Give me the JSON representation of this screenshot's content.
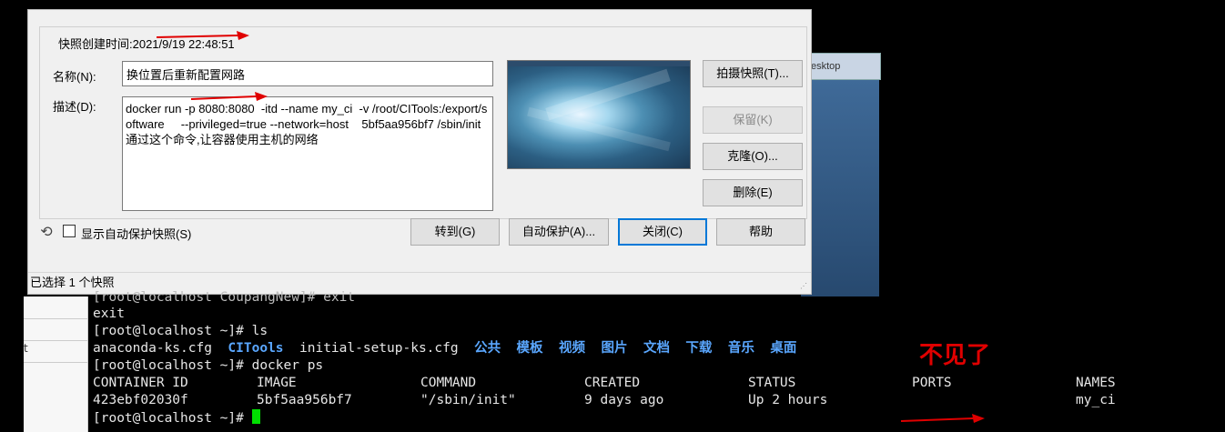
{
  "background_window": {
    "title": "esktop"
  },
  "dialog": {
    "snapshot_created_label": "快照创建时间:2021/9/19 22:48:51",
    "name_label": "名称(N):",
    "name_value": "换位置后重新配置网路",
    "desc_label": "描述(D):",
    "desc_value": "docker run -p 8080:8080  -itd --name my_ci  -v /root/CITools:/export/software     --privileged=true --network=host    5bf5aa956bf7 /sbin/init 通过这个命令,让容器使用主机的网络",
    "buttons": {
      "take_snapshot": "拍摄快照(T)...",
      "keep": "保留(K)",
      "clone": "克隆(O)...",
      "delete": "删除(E)",
      "goto": "转到(G)",
      "autoprotect": "自动保护(A)...",
      "close": "关闭(C)",
      "help": "帮助"
    },
    "show_autoprotect_label": "显示自动保护快照(S)",
    "show_autoprotect_checked": false,
    "status": "已选择 1 个快照"
  },
  "terminal": {
    "partial_top": "[root@localhost CoupangNew]# exit",
    "lines": [
      "exit",
      "[root@localhost ~]# ls"
    ],
    "ls_output": {
      "plain1": "anaconda-ks.cfg",
      "blue1": "CITools",
      "plain2": "initial-setup-ks.cfg",
      "dirs": [
        "公共",
        "模板",
        "视频",
        "图片",
        "文档",
        "下载",
        "音乐",
        "桌面"
      ]
    },
    "docker_cmd": "[root@localhost ~]# docker ps",
    "headers": [
      "CONTAINER ID",
      "IMAGE",
      "COMMAND",
      "CREATED",
      "STATUS",
      "PORTS",
      "NAMES"
    ],
    "row": [
      "423ebf02030f",
      "5bf5aa956bf7",
      "\"/sbin/init\"",
      "9 days ago",
      "Up 2 hours",
      "",
      "my_ci"
    ],
    "prompt": "[root@localhost ~]#",
    "left_strip_text": "t"
  },
  "annotation": {
    "text": "不见了",
    "color": "#e00000"
  }
}
